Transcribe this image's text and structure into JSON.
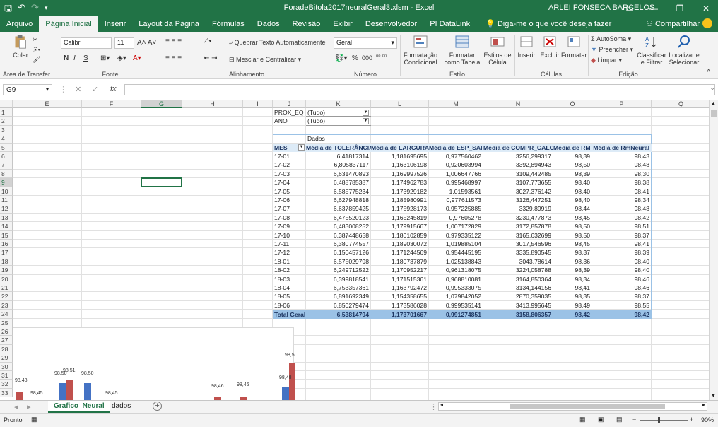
{
  "window": {
    "title": "ForadeBitola2017neuralGeral3.xlsm - Excel",
    "user": "ARLEI FONSECA BARCELOS"
  },
  "tabs": [
    "Arquivo",
    "Página Inicial",
    "Inserir",
    "Layout da Página",
    "Fórmulas",
    "Dados",
    "Revisão",
    "Exibir",
    "Desenvolvedor",
    "PI DataLink"
  ],
  "tell_me": "Diga-me o que você deseja fazer",
  "share": "Compartilhar",
  "ribbon": {
    "clipboard": {
      "paste": "Colar",
      "label": "Área de Transfer..."
    },
    "font": {
      "name": "Calibri",
      "size": "11",
      "label": "Fonte",
      "bold": "N",
      "italic": "I",
      "underline": "S"
    },
    "alignment": {
      "wrap": "Quebrar Texto Automaticamente",
      "merge": "Mesclar e Centralizar",
      "label": "Alinhamento"
    },
    "number": {
      "format": "Geral",
      "percent": "%",
      "thousands": "000",
      "label": "Número"
    },
    "styles": {
      "cond": "Formatação Condicional",
      "table": "Formatar como Tabela",
      "cell": "Estilos de Célula",
      "label": "Estilo"
    },
    "cells": {
      "insert": "Inserir",
      "delete": "Excluir",
      "format": "Formatar",
      "label": "Células"
    },
    "editing": {
      "autosum": "AutoSoma",
      "fill": "Preencher",
      "clear": "Limpar",
      "sort": "Classificar e Filtrar",
      "find": "Localizar e Selecionar",
      "label": "Edição"
    }
  },
  "formula_bar": {
    "name_box": "G9",
    "fx": "fx",
    "formula": ""
  },
  "columns": [
    "E",
    "F",
    "G",
    "H",
    "I",
    "J",
    "K",
    "L",
    "M",
    "N",
    "O",
    "P",
    "Q"
  ],
  "rows": [
    "1",
    "2",
    "3",
    "4",
    "5",
    "6",
    "7",
    "8",
    "9",
    "10",
    "11",
    "12",
    "13",
    "14",
    "15",
    "16",
    "17",
    "18",
    "19",
    "20",
    "21",
    "22",
    "23",
    "24",
    "25",
    "26",
    "27",
    "28",
    "29",
    "30",
    "31",
    "32",
    "33"
  ],
  "pivot": {
    "filters": [
      {
        "field": "PROX_EQ",
        "value": "(Tudo)"
      },
      {
        "field": "ANO",
        "value": "(Tudo)"
      }
    ],
    "values_label": "Dados",
    "headers": [
      "MES",
      "Média de TOLERÂNCIA",
      "Média de LARGURA",
      "Média de ESP_SAI",
      "Média de COMPR_CALC",
      "Média de RM",
      "Média de RmNeural"
    ],
    "rows": [
      [
        "17-01",
        "6,41817314",
        "1,181695695",
        "0,977560462",
        "3256,299317",
        "98,39",
        "98,43"
      ],
      [
        "17-02",
        "6,805837117",
        "1,163106198",
        "0,920603994",
        "3392,894943",
        "98,50",
        "98,48"
      ],
      [
        "17-03",
        "6,631470893",
        "1,169997526",
        "1,006647766",
        "3109,442485",
        "98,39",
        "98,30"
      ],
      [
        "17-04",
        "6,488785387",
        "1,174962783",
        "0,995468997",
        "3107,773655",
        "98,40",
        "98,38"
      ],
      [
        "17-05",
        "6,585775234",
        "1,173929182",
        "1,01593561",
        "3027,376142",
        "98,40",
        "98,41"
      ],
      [
        "17-06",
        "6,627948818",
        "1,185980991",
        "0,977611573",
        "3126,447251",
        "98,40",
        "98,34"
      ],
      [
        "17-07",
        "6,637859425",
        "1,175928173",
        "0,957225885",
        "3329,89919",
        "98,44",
        "98,48"
      ],
      [
        "17-08",
        "6,475520123",
        "1,165245819",
        "0,97605278",
        "3230,477873",
        "98,45",
        "98,42"
      ],
      [
        "17-09",
        "6,483008252",
        "1,179915667",
        "1,007172829",
        "3172,857878",
        "98,50",
        "98,51"
      ],
      [
        "17-10",
        "6,387448658",
        "1,180102859",
        "0,979335122",
        "3165,632699",
        "98,50",
        "98,37"
      ],
      [
        "17-11",
        "6,380774557",
        "1,189030072",
        "1,019885104",
        "3017,546596",
        "98,45",
        "98,41"
      ],
      [
        "17-12",
        "6,150457126",
        "1,171244569",
        "0,954445195",
        "3335,890545",
        "98,37",
        "98,39"
      ],
      [
        "18-01",
        "6,575029798",
        "1,180737879",
        "1,025138843",
        "3043,78614",
        "98,36",
        "98,40"
      ],
      [
        "18-02",
        "6,249712522",
        "1,170952217",
        "0,961318075",
        "3224,058788",
        "98,39",
        "98,40"
      ],
      [
        "18-03",
        "6,399818541",
        "1,171515361",
        "0,968810081",
        "3164,850364",
        "98,34",
        "98,46"
      ],
      [
        "18-04",
        "6,753357361",
        "1,163792472",
        "0,995333075",
        "3134,144156",
        "98,41",
        "98,46"
      ],
      [
        "18-05",
        "6,891692349",
        "1,154358655",
        "1,079842052",
        "2870,359035",
        "98,35",
        "98,37"
      ],
      [
        "18-06",
        "6,850279474",
        "1,173586028",
        "0,999535141",
        "3413,995645",
        "98,49",
        "98,55"
      ]
    ],
    "total": [
      "Total Geral",
      "6,53814794",
      "1,173701667",
      "0,991274851",
      "3158,806357",
      "98,42",
      "98,42"
    ]
  },
  "chart_data": {
    "type": "bar",
    "note_labels": [
      "98,48",
      "98,45",
      "98,50",
      "98,51",
      "98,50",
      "98,45",
      "98,46",
      "98,46",
      "98,48",
      "98,55"
    ],
    "series_colors": [
      "#4472c4",
      "#c0504d"
    ]
  },
  "sheet_tabs": [
    "Grafico_Neural",
    "dados"
  ],
  "status": {
    "ready": "Pronto",
    "zoom": "90%"
  }
}
